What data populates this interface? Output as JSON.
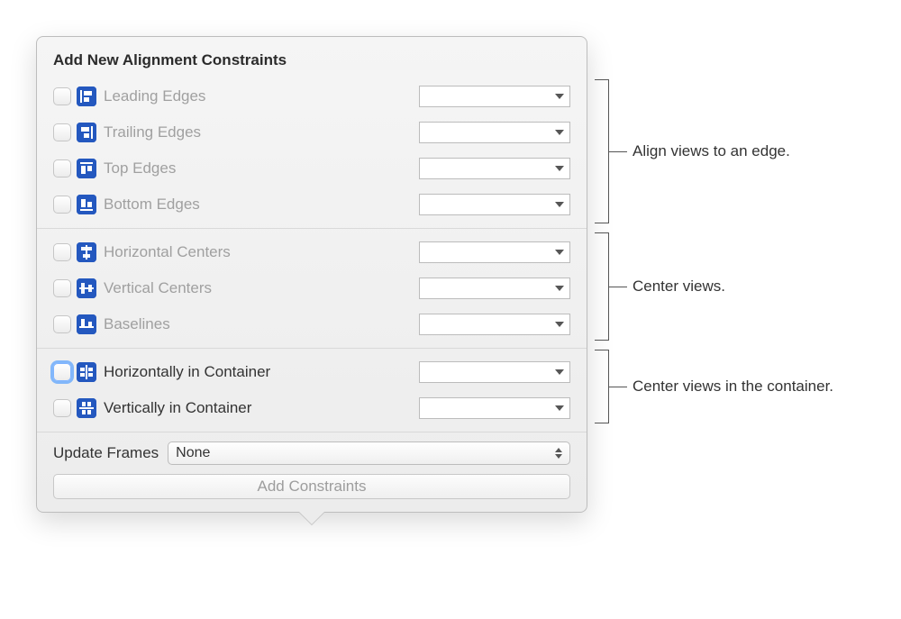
{
  "title": "Add New Alignment Constraints",
  "groups": {
    "edges": [
      {
        "id": "leading-edges",
        "label": "Leading Edges",
        "enabled": false,
        "icon": "align-leading-icon"
      },
      {
        "id": "trailing-edges",
        "label": "Trailing Edges",
        "enabled": false,
        "icon": "align-trailing-icon"
      },
      {
        "id": "top-edges",
        "label": "Top Edges",
        "enabled": false,
        "icon": "align-top-icon"
      },
      {
        "id": "bottom-edges",
        "label": "Bottom Edges",
        "enabled": false,
        "icon": "align-bottom-icon"
      }
    ],
    "centers": [
      {
        "id": "horizontal-centers",
        "label": "Horizontal Centers",
        "enabled": false,
        "icon": "align-hcenter-icon"
      },
      {
        "id": "vertical-centers",
        "label": "Vertical Centers",
        "enabled": false,
        "icon": "align-vcenter-icon"
      },
      {
        "id": "baselines",
        "label": "Baselines",
        "enabled": false,
        "icon": "align-baseline-icon"
      }
    ],
    "container": [
      {
        "id": "horizontally-in-container",
        "label": "Horizontally in Container",
        "enabled": true,
        "focused": true,
        "icon": "align-hcontainer-icon"
      },
      {
        "id": "vertically-in-container",
        "label": "Vertically in Container",
        "enabled": true,
        "focused": false,
        "icon": "align-vcontainer-icon"
      }
    ]
  },
  "updateFrames": {
    "label": "Update Frames",
    "value": "None"
  },
  "addButton": "Add Constraints",
  "annotations": {
    "edges": "Align views to an edge.",
    "centers": "Center views.",
    "container": "Center views in the container."
  },
  "icons": {
    "align-leading-icon": "<svg width='22' height='22'><rect width='22' height='22' rx='4' fill='#2458bf'/><rect x='4' y='4' width='2' height='14' fill='#fff'/><rect x='8' y='5' width='9' height='5' fill='#fff'/><rect x='8' y='12' width='6' height='5' fill='#fff'/></svg>",
    "align-trailing-icon": "<svg width='22' height='22'><rect width='22' height='22' rx='4' fill='#2458bf'/><rect x='16' y='4' width='2' height='14' fill='#fff'/><rect x='5' y='5' width='9' height='5' fill='#fff'/><rect x='8' y='12' width='6' height='5' fill='#fff'/></svg>",
    "align-top-icon": "<svg width='22' height='22'><rect width='22' height='22' rx='4' fill='#2458bf'/><rect x='4' y='4' width='14' height='2' fill='#fff'/><rect x='5' y='8' width='5' height='9' fill='#fff'/><rect x='12' y='8' width='5' height='6' fill='#fff'/></svg>",
    "align-bottom-icon": "<svg width='22' height='22'><rect width='22' height='22' rx='4' fill='#2458bf'/><rect x='4' y='16' width='14' height='2' fill='#fff'/><rect x='5' y='5' width='5' height='9' fill='#fff'/><rect x='12' y='8' width='5' height='6' fill='#fff'/></svg>",
    "align-hcenter-icon": "<svg width='22' height='22'><rect width='22' height='22' rx='4' fill='#2458bf'/><rect x='10' y='3' width='2' height='16' fill='#fff'/><rect x='5' y='5' width='12' height='4' fill='#fff' fill-opacity='0.95'/><rect x='7' y='13' width='8' height='4' fill='#fff' fill-opacity='0.95'/></svg>",
    "align-vcenter-icon": "<svg width='22' height='22'><rect width='22' height='22' rx='4' fill='#2458bf'/><rect x='3' y='10' width='16' height='2' fill='#fff'/><rect x='5' y='5' width='4' height='12' fill='#fff' fill-opacity='0.95'/><rect x='13' y='7' width='4' height='8' fill='#fff' fill-opacity='0.95'/></svg>",
    "align-baseline-icon": "<svg width='22' height='22'><rect width='22' height='22' rx='4' fill='#2458bf'/><rect x='3' y='13' width='16' height='2' fill='#fff'/><rect x='5' y='5' width='4' height='8' fill='#fff'/><rect x='13' y='8' width='4' height='5' fill='#fff'/></svg>",
    "align-hcontainer-icon": "<svg width='22' height='22'><rect width='22' height='22' rx='4' fill='#2458bf'/><rect x='10' y='3' width='2' height='16' fill='#fff'/><rect x='4' y='6' width='5' height='4' fill='#fff'/><rect x='13' y='6' width='5' height='4' fill='#fff'/><rect x='4' y='12' width='5' height='4' fill='#fff'/><rect x='13' y='12' width='5' height='4' fill='#fff'/></svg>",
    "align-vcontainer-icon": "<svg width='22' height='22'><rect width='22' height='22' rx='4' fill='#2458bf'/><rect x='3' y='10' width='16' height='2' fill='#fff'/><rect x='6' y='4' width='4' height='5' fill='#fff'/><rect x='6' y='13' width='4' height='5' fill='#fff'/><rect x='12' y='4' width='4' height='5' fill='#fff'/><rect x='12' y='13' width='4' height='5' fill='#fff'/></svg>"
  }
}
